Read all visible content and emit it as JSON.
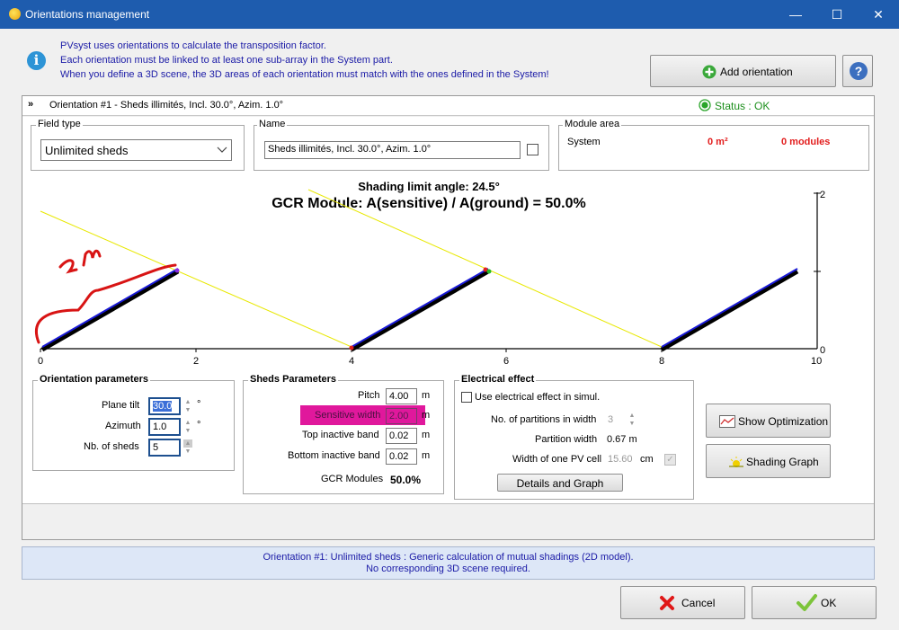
{
  "window": {
    "title": "Orientations management",
    "minimize": "—",
    "maximize": "☐",
    "close": "✕"
  },
  "info": {
    "lines": [
      "PVsyst uses orientations to calculate the transposition factor.",
      "Each orientation must be linked to at least one sub-array in the System part.",
      "When you define a 3D scene, the 3D areas of each orientation must match with the ones defined in the System!"
    ],
    "add_orientation": "Add orientation",
    "help": "?"
  },
  "orientation": {
    "header": "Orientation #1 - Sheds illimités, Incl. 30.0°, Azim. 1.0°",
    "status": "Status : OK",
    "field_type_legend": "Field type",
    "field_type_value": "Unlimited sheds",
    "name_legend": "Name",
    "name_value": "Sheds illimités, Incl. 30.0°, Azim. 1.0°",
    "module_area_legend": "Module area",
    "module_area_system": "System",
    "module_area_m2": "0 m²",
    "module_area_modules": "0 modules"
  },
  "graph": {
    "title1": "Shading limit angle:  24.5°",
    "title2": "GCR Module: A(sensitive) / A(ground) = 50.0%",
    "x_ticks": [
      "0",
      "2",
      "4",
      "6",
      "8",
      "10"
    ],
    "y_ticks": [
      "2",
      "0"
    ],
    "annotation": "2 m"
  },
  "orient_params": {
    "legend": "Orientation parameters",
    "plane_tilt_label": "Plane tilt",
    "plane_tilt": "30.0",
    "azimuth_label": "Azimuth",
    "azimuth": "1.0",
    "nb_sheds_label": "Nb. of sheds",
    "nb_sheds": "5",
    "deg": "°"
  },
  "sheds": {
    "legend": "Sheds Parameters",
    "pitch_label": "Pitch",
    "pitch": "4.00",
    "sensitive_label": "Sensitive width",
    "sensitive": "2.00",
    "top_label": "Top inactive band",
    "top": "0.02",
    "bottom_label": "Bottom inactive band",
    "bottom": "0.02",
    "gcr_label": "GCR Modules",
    "gcr": "50.0%",
    "unit": "m"
  },
  "electrical": {
    "legend": "Electrical effect",
    "use_label": "Use electrical effect in simul.",
    "partitions_label": "No. of partitions in width",
    "partitions": "3",
    "partition_width_label": "Partition width",
    "partition_width": "0.67 m",
    "cell_label": "Width of one PV cell",
    "cell": "15.60",
    "cell_unit": "cm",
    "details_button": "Details and Graph"
  },
  "side_buttons": {
    "optimization": "Show Optimization",
    "shading": "Shading Graph"
  },
  "status_message": [
    "Orientation #1: Unlimited sheds : Generic calculation of mutual shadings (2D model).",
    "No corresponding 3D scene required."
  ],
  "footer": {
    "cancel": "Cancel",
    "ok": "OK"
  }
}
